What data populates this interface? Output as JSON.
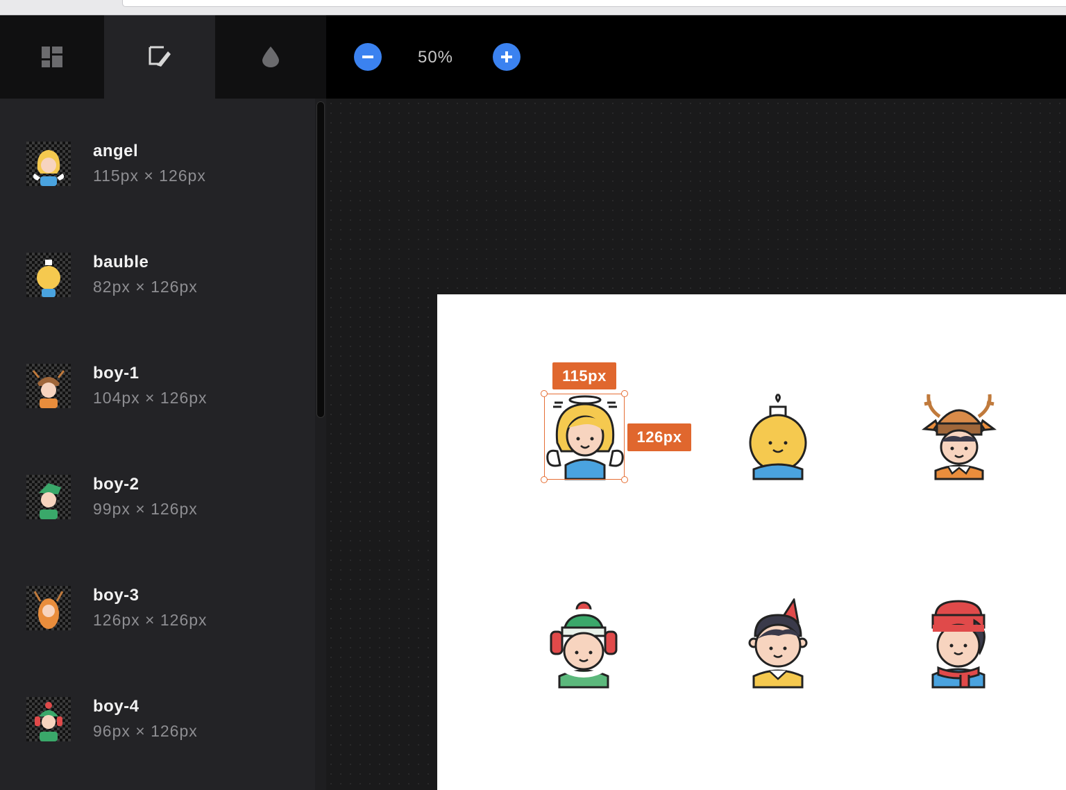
{
  "tabs": [
    {
      "name": "sprites",
      "icon": "dashboard-icon",
      "active": false
    },
    {
      "name": "edit",
      "icon": "edit-icon",
      "active": true
    },
    {
      "name": "color",
      "icon": "droplet-icon",
      "active": false
    }
  ],
  "toolbar": {
    "zoom_out_icon": "minus-icon",
    "zoom_level": "50%",
    "zoom_in_icon": "plus-icon",
    "accent": "#3b82f0"
  },
  "sprites": [
    {
      "name": "angel",
      "size": "115px × 126px"
    },
    {
      "name": "bauble",
      "size": "82px × 126px"
    },
    {
      "name": "boy-1",
      "size": "104px × 126px"
    },
    {
      "name": "boy-2",
      "size": "99px × 126px"
    },
    {
      "name": "boy-3",
      "size": "126px × 126px"
    },
    {
      "name": "boy-4",
      "size": "96px × 126px"
    }
  ],
  "selection": {
    "width_label": "115px",
    "height_label": "126px",
    "color": "#e0672e"
  }
}
